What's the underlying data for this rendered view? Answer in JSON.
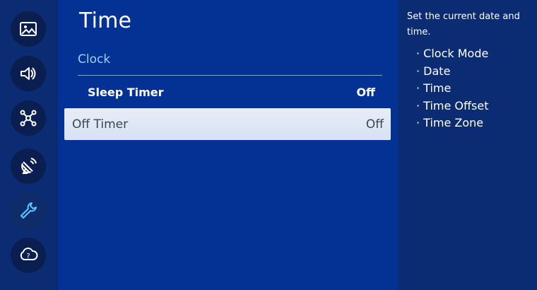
{
  "sidebar": {
    "items": [
      {
        "icon": "picture-icon"
      },
      {
        "icon": "sound-icon"
      },
      {
        "icon": "network-icon"
      },
      {
        "icon": "broadcasting-icon"
      },
      {
        "icon": "general-tools-icon",
        "active": true
      },
      {
        "icon": "support-icon"
      }
    ]
  },
  "main": {
    "title": "Time",
    "section_label": "Clock",
    "rows": [
      {
        "name": "Sleep Timer",
        "value": "Off"
      },
      {
        "name": "Off Timer",
        "value": "Off",
        "selected": true
      }
    ]
  },
  "help": {
    "description": "Set the current date and time.",
    "items": [
      "Clock Mode",
      "Date",
      "Time",
      "Time Offset",
      "Time Zone"
    ]
  },
  "colors": {
    "main_bg": "#033194",
    "sidebar_bg": "#0b2b73",
    "section_label": "#9fd0ff",
    "selected_row_bg": "#dfe7f5",
    "active_icon": "#58c6ff"
  }
}
